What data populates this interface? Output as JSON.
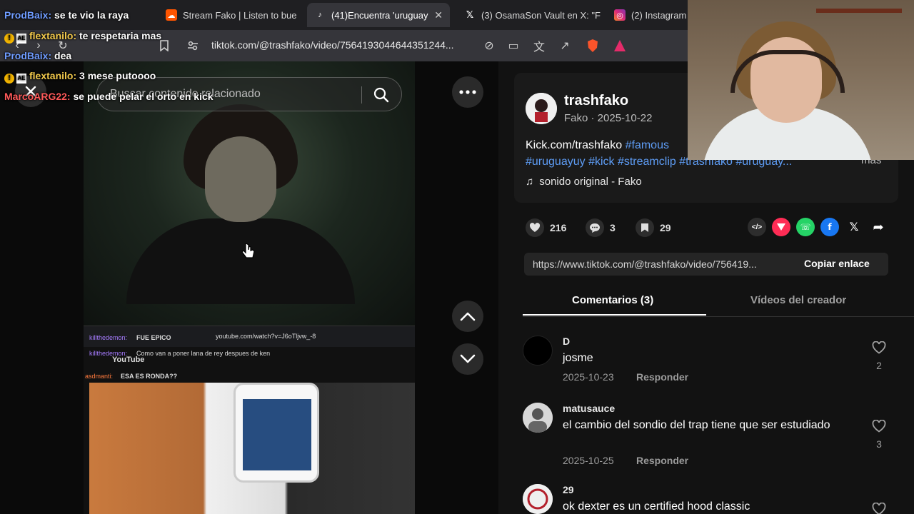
{
  "browser": {
    "tabs": [
      {
        "label": "",
        "icon": "tiktok-icon"
      },
      {
        "label": "Stream Fako | Listen to bue",
        "icon": "soundcloud-icon"
      },
      {
        "label": "(41)Encuentra 'uruguay",
        "icon": "tiktok-icon",
        "active": true
      },
      {
        "label": "(3) OsamaSon Vault en X: \"F",
        "icon": "x-icon"
      },
      {
        "label": "(2) Instagram",
        "icon": "instagram-icon"
      }
    ],
    "url": "tiktok.com/@trashfako/video/7564193044644351244..."
  },
  "chat": [
    {
      "user": "ProdBaix:",
      "message": "se te vio la raya",
      "color": "#6f9cff",
      "badge": false
    },
    {
      "user": "flextanilo:",
      "message": "te respetaria mas",
      "color": "#f2c94c",
      "badge": true
    },
    {
      "user": "ProdBaix:",
      "message": "dea",
      "color": "#6f9cff",
      "badge": false
    },
    {
      "user": "flextanilo:",
      "message": "3 mese putoooo",
      "color": "#f2c94c",
      "badge": true
    },
    {
      "user": "MarcoARG22:",
      "message": "se puede pelar el orto en kick",
      "color": "#ff5a5a",
      "badge": false
    }
  ],
  "search": {
    "placeholder": "Buscar contenido relacionado"
  },
  "video": {
    "inner_url": "youtube.com/watch?v=J6oTljvw_-8",
    "inner_chat": [
      {
        "user": "killthedemon:",
        "message": "FUE EPICO"
      },
      {
        "user": "killthedemon:",
        "message": "Como van a poner lana de rey despues de ken"
      },
      {
        "user": "asdmanti:",
        "message": "ESA ES RONDA??"
      }
    ],
    "inner_logo": "YouTube"
  },
  "post": {
    "author": "trashfako",
    "meta": "Fako · 2025-10-22",
    "desc_prefix": "Kick.com/trashfako ",
    "hashtags_line1": "#famous",
    "hashtags_line2": "#uruguayuy #kick #streamclip #trashfako #uruguay...",
    "more": "más",
    "sound": "sonido original - Fako",
    "likes": "216",
    "comments": "3",
    "saves": "29",
    "link": "https://www.tiktok.com/@trashfako/video/756419...",
    "copy_label": "Copiar enlace"
  },
  "tabs": {
    "comments": "Comentarios (3)",
    "creator": "Vídeos del creador"
  },
  "comments": [
    {
      "user": "D",
      "text": "josme",
      "date": "2025-10-23",
      "reply": "Responder",
      "likes": "2"
    },
    {
      "user": "matusauce",
      "text": "el cambio del sondio del trap tiene que ser estudiado",
      "date": "2025-10-25",
      "reply": "Responder",
      "likes": "3"
    },
    {
      "user": "29",
      "text": "ok dexter es un certified hood classic",
      "date": "",
      "reply": "",
      "likes": ""
    }
  ],
  "colors": {
    "hashtag": "#5e9df6",
    "tiktok_red": "#fe2c55",
    "whatsapp": "#25d366",
    "facebook": "#1877f2"
  }
}
